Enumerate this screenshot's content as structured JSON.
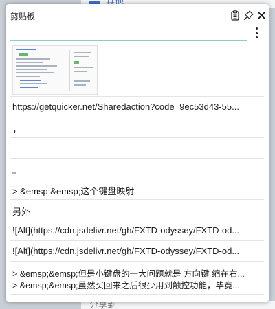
{
  "background": {
    "top_text": "其他",
    "bottom_text": "分享到"
  },
  "panel": {
    "title": "剪贴板",
    "search": {
      "value": "",
      "placeholder": ""
    }
  },
  "items": [
    {
      "type": "image",
      "description": "screenshot thumbnail"
    },
    {
      "type": "text",
      "line1": "https://getquicker.net/Sharedaction?code=9ec53d43-55..."
    },
    {
      "type": "text",
      "line1": "，"
    },
    {
      "type": "text",
      "line1": ""
    },
    {
      "type": "text",
      "line1": "。"
    },
    {
      "type": "text",
      "line1": "> &emsp;&emsp;这个键盘映射"
    },
    {
      "type": "text",
      "line1": "另外"
    },
    {
      "type": "text",
      "line1": "![Alt](https://cdn.jsdelivr.net/gh/FXTD-odyssey/FXTD-od..."
    },
    {
      "type": "text",
      "line1": "![Alt](https://cdn.jsdelivr.net/gh/FXTD-odyssey/FXTD-od..."
    },
    {
      "type": "text",
      "line1": "> &emsp;&emsp;但是小键盘的一大问题就是 方向键 缩在右...",
      "line2": "> &emsp;&emsp;虽然买回来之后很少用到触控功能，毕竟..."
    }
  ],
  "icons": {
    "clipboard": "clipboard-icon",
    "pin": "pin-icon",
    "close": "close-icon",
    "more": "more-vertical-icon"
  }
}
